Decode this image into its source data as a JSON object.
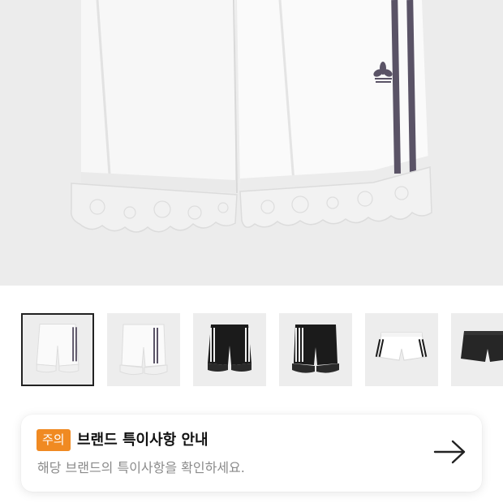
{
  "product": {
    "hero_image": "white lace-trim shorts with purple side stripes and trefoil logo",
    "thumbnails": [
      {
        "icon": "white-lace-shorts-front",
        "selected": true
      },
      {
        "icon": "white-lace-shorts-side",
        "selected": false
      },
      {
        "icon": "black-lace-shorts-front",
        "selected": false
      },
      {
        "icon": "black-lace-shorts-back",
        "selected": false
      },
      {
        "icon": "white-running-shorts",
        "selected": false
      },
      {
        "icon": "black-running-shorts",
        "selected": false
      }
    ]
  },
  "notice": {
    "badge": "주의",
    "title": "브랜드 특이사항 안내",
    "description": "해당 브랜드의 특이사항을 확인하세요.",
    "arrow_icon": "arrow-right-icon"
  },
  "colors": {
    "badge": "#f08a22",
    "stripe": "#5a5366"
  }
}
